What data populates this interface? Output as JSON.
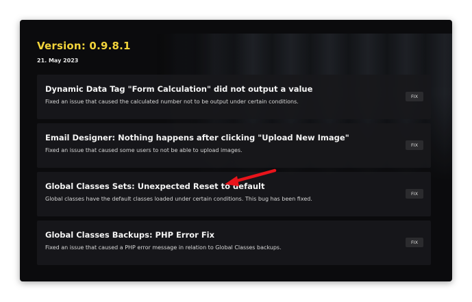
{
  "release": {
    "version": "Version: 0.9.8.1",
    "date": "21. May 2023"
  },
  "changes": [
    {
      "title": "Dynamic Data Tag \"Form Calculation\" did not output a value",
      "description": "Fixed an issue that caused the calculated number not to be output under certain conditions.",
      "badge": "FIX"
    },
    {
      "title": "Email Designer: Nothing happens after clicking \"Upload New Image\"",
      "description": "Fixed an issue that caused some users to not be able to upload images.",
      "badge": "FIX"
    },
    {
      "title": "Global Classes Sets: Unexpected Reset to default",
      "description": "Global classes have the default classes loaded under certain conditions. This bug has been fixed.",
      "badge": "FIX"
    },
    {
      "title": "Global Classes Backups: PHP Error Fix",
      "description": "Fixed an issue that caused a PHP error message in relation to Global Classes backups.",
      "badge": "FIX"
    }
  ],
  "colors": {
    "version_accent": "#f2d43b",
    "annotation_arrow": "#e8141b"
  },
  "icons": {
    "annotation": "arrow-icon"
  }
}
